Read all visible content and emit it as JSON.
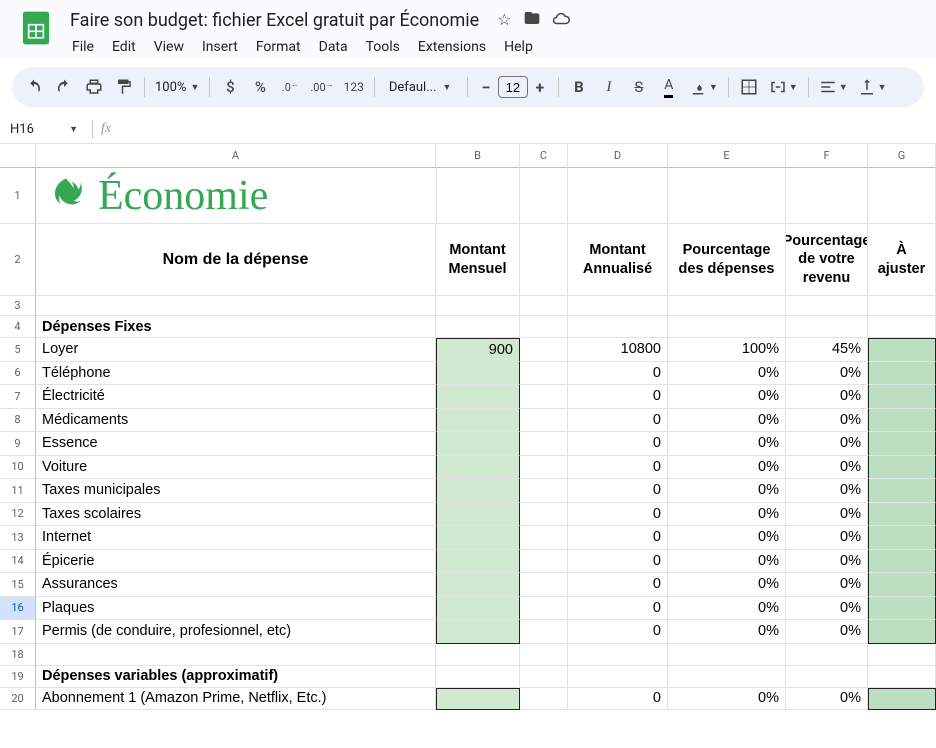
{
  "doc": {
    "title": "Faire son budget: fichier Excel gratuit par Économie"
  },
  "menus": [
    "File",
    "Edit",
    "View",
    "Insert",
    "Format",
    "Data",
    "Tools",
    "Extensions",
    "Help"
  ],
  "toolbar": {
    "zoom": "100%",
    "font": "Defaul...",
    "fontSize": "12",
    "decimals_less": ".0",
    "decimals_more": ".00",
    "number_fmt": "123"
  },
  "namebox": "H16",
  "columns": [
    "A",
    "B",
    "C",
    "D",
    "E",
    "F",
    "G"
  ],
  "brand": "Économie",
  "headers": {
    "A": "Nom de la dépense",
    "B": "Montant Mensuel",
    "D": "Montant Annualisé",
    "E": "Pourcentage des dépenses",
    "F": "Pourcentage de votre revenu",
    "G": "À ajuster"
  },
  "sections": {
    "fixed": "Dépenses Fixes",
    "variable": "Dépenses variables (approximatif)"
  },
  "rows": [
    {
      "n": 5,
      "name": "Loyer",
      "b": "900",
      "d": "10800",
      "e": "100%",
      "f": "45%"
    },
    {
      "n": 6,
      "name": "Téléphone",
      "b": "",
      "d": "0",
      "e": "0%",
      "f": "0%"
    },
    {
      "n": 7,
      "name": "Électricité",
      "b": "",
      "d": "0",
      "e": "0%",
      "f": "0%"
    },
    {
      "n": 8,
      "name": "Médicaments",
      "b": "",
      "d": "0",
      "e": "0%",
      "f": "0%"
    },
    {
      "n": 9,
      "name": "Essence",
      "b": "",
      "d": "0",
      "e": "0%",
      "f": "0%"
    },
    {
      "n": 10,
      "name": "Voiture",
      "b": "",
      "d": "0",
      "e": "0%",
      "f": "0%"
    },
    {
      "n": 11,
      "name": "Taxes municipales",
      "b": "",
      "d": "0",
      "e": "0%",
      "f": "0%"
    },
    {
      "n": 12,
      "name": "Taxes scolaires",
      "b": "",
      "d": "0",
      "e": "0%",
      "f": "0%"
    },
    {
      "n": 13,
      "name": "Internet",
      "b": "",
      "d": "0",
      "e": "0%",
      "f": "0%"
    },
    {
      "n": 14,
      "name": "Épicerie",
      "b": "",
      "d": "0",
      "e": "0%",
      "f": "0%"
    },
    {
      "n": 15,
      "name": "Assurances",
      "b": "",
      "d": "0",
      "e": "0%",
      "f": "0%"
    },
    {
      "n": 16,
      "name": "Plaques",
      "b": "",
      "d": "0",
      "e": "0%",
      "f": "0%"
    },
    {
      "n": 17,
      "name": "Permis (de conduire, profesionnel, etc)",
      "b": "",
      "d": "0",
      "e": "0%",
      "f": "0%"
    }
  ],
  "variable_row": {
    "n": 20,
    "name": "Abonnement 1 (Amazon Prime, Netflix, Etc.)",
    "b": "",
    "d": "0",
    "e": "0%",
    "f": "0%"
  }
}
